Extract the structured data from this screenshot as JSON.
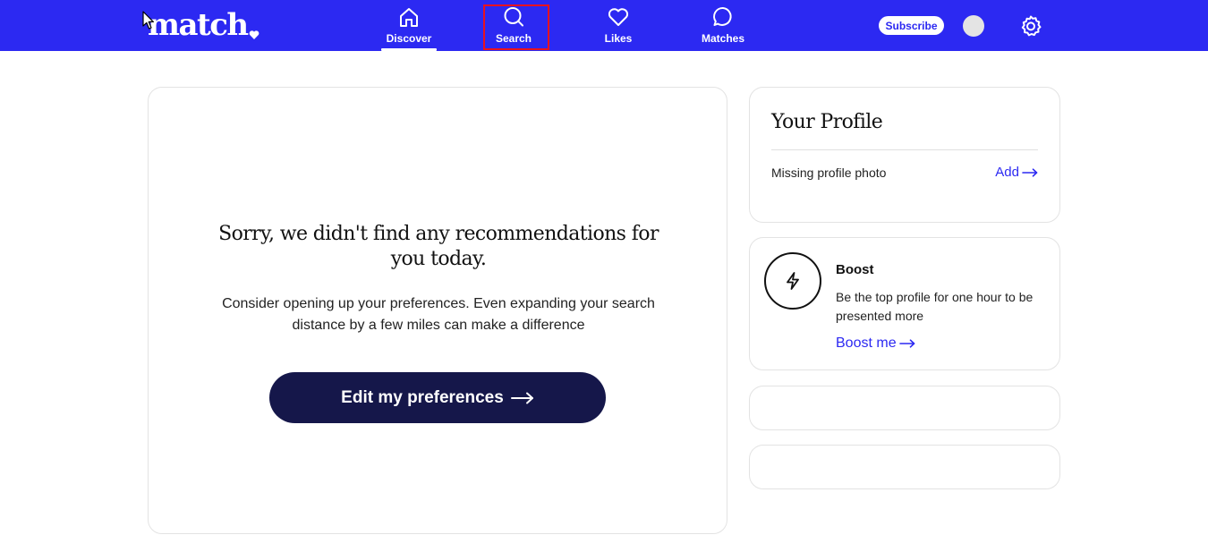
{
  "brand": {
    "logo_text": "match",
    "color": "#2c29f2",
    "dark": "#15174a"
  },
  "nav": {
    "items": [
      {
        "label": "Discover",
        "icon": "home-icon"
      },
      {
        "label": "Search",
        "icon": "search-icon"
      },
      {
        "label": "Likes",
        "icon": "heart-icon"
      },
      {
        "label": "Matches",
        "icon": "chat-bubble-icon"
      }
    ],
    "subscribe_label": "Subscribe",
    "settings_icon": "gear-icon"
  },
  "main": {
    "title": "Sorry, we didn't find any recommendations for you today.",
    "description": "Consider opening up your preferences. Even expanding your search distance by a few miles can make a difference",
    "cta_label": "Edit my preferences"
  },
  "profile": {
    "title": "Your Profile",
    "missing_label": "Missing profile photo",
    "add_label": "Add"
  },
  "boost": {
    "icon": "lightning-icon",
    "title": "Boost",
    "description": "Be the top profile for one hour to be presented more",
    "link_label": "Boost me"
  }
}
